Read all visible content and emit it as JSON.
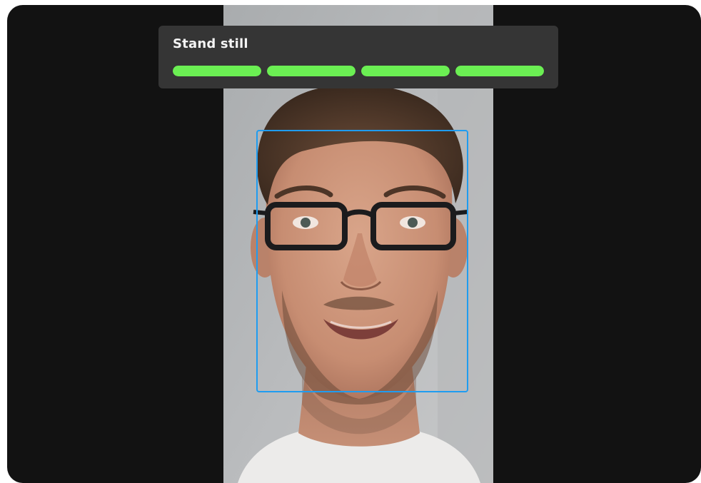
{
  "status": {
    "message": "Stand still",
    "steps_total": 4,
    "steps_completed": 4,
    "progress_color": "#6bef53"
  },
  "face_detection": {
    "box_color": "#1f9cf0",
    "face_detected": true
  },
  "camera": {
    "subject": "man-with-glasses-portrait"
  }
}
